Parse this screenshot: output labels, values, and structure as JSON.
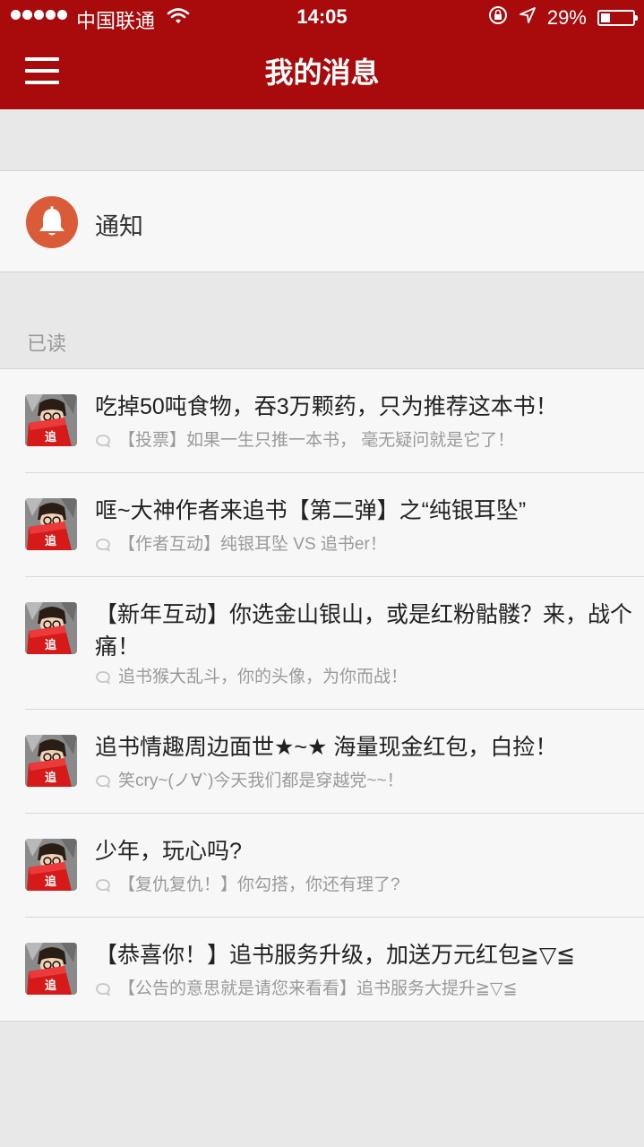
{
  "status_bar": {
    "carrier": "中国联通",
    "time": "14:05",
    "battery_percent": "29%",
    "battery_level": 0.29
  },
  "header": {
    "title": "我的消息",
    "menu_icon": "hamburger-menu-icon"
  },
  "notification_row": {
    "icon": "bell-icon",
    "label": "通知",
    "icon_color": "#d95b38"
  },
  "section_label": "已读",
  "colors": {
    "brand": "#a90b0c",
    "background": "#e8e8e8",
    "row": "#f7f7f7"
  },
  "messages": [
    {
      "title": "吃掉50吨食物，吞3万颗药，只为推荐这本书！",
      "preview": "【投票】如果一生只推一本书， 毫无疑问就是它了！"
    },
    {
      "title": "哐~大神作者来追书【第二弹】之“纯银耳坠”",
      "preview": "【作者互动】纯银耳坠 VS 追书er！"
    },
    {
      "title": "【新年互动】你选金山银山，或是红粉骷髅？来，战个痛！",
      "preview": "追书猴大乱斗，你的头像，为你而战！"
    },
    {
      "title": "追书情趣周边面世★~★ 海量现金红包，白捡！",
      "preview": "笑cry~(ノ∀`)今天我们都是穿越党~~！"
    },
    {
      "title": "少年，玩心吗?",
      "preview": "【复仇复仇！】你勾搭，你还有理了?"
    },
    {
      "title": "【恭喜你！】追书服务升级，加送万元红包≧▽≦",
      "preview": "【公告的意思就是请您来看看】追书服务大提升≧▽≦"
    }
  ]
}
